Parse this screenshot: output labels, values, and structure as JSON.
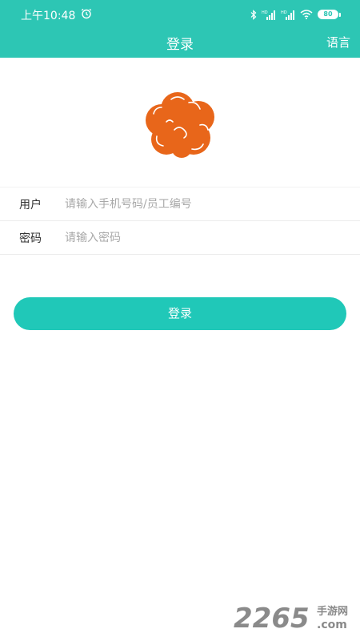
{
  "status_bar": {
    "time": "上午10:48",
    "battery": "80",
    "icons": [
      "alarm-icon",
      "bluetooth-icon",
      "signal-hd-icon",
      "signal-hd-icon",
      "wifi-icon",
      "battery-icon"
    ]
  },
  "nav": {
    "title": "登录",
    "language_label": "语言"
  },
  "form": {
    "username": {
      "label": "用户",
      "placeholder": "请输入手机号码/员工编号",
      "value": ""
    },
    "password": {
      "label": "密码",
      "placeholder": "请输入密码",
      "value": ""
    }
  },
  "login_button": "登录",
  "watermark": {
    "digits": "2265",
    "suffix_top": "手游网",
    "suffix_bottom": ".com"
  },
  "colors": {
    "header": "#2dc6b4",
    "button": "#20c8b8",
    "logo": "#e8661a",
    "watermark": "#8a8a8a"
  }
}
